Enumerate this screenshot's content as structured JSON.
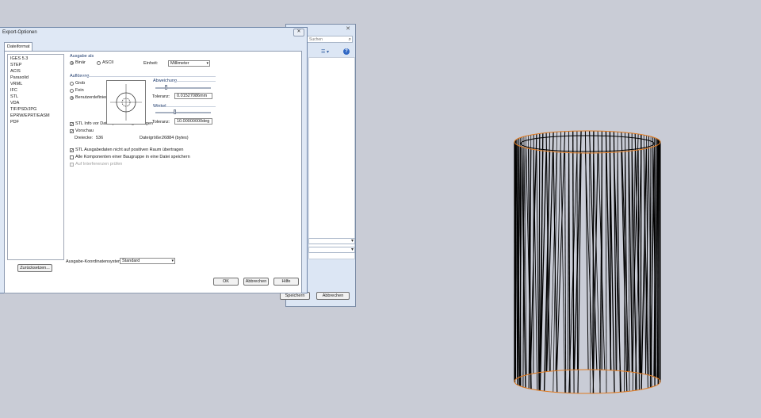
{
  "background_dialog": {
    "search_placeholder": "Suchen",
    "save_label": "Speichern",
    "cancel_label": "Abbrechen"
  },
  "export_dialog": {
    "title": "Export-Optionen",
    "close_label": "×",
    "tab_label": "Dateiformat",
    "formats": [
      "IGES 5.3",
      "STEP",
      "ACIS",
      "Parasolid",
      "VRML",
      "IFC",
      "STL",
      "VDA",
      "TIF/PSD/JPG",
      "EPRW/EPRT/EASM",
      "PDF"
    ],
    "output_as": {
      "label": "Ausgabe als",
      "binary_label": "Binär",
      "ascii_label": "ASCII",
      "selected": "Binär"
    },
    "unit": {
      "label": "Einheit:",
      "value": "Millimeter"
    },
    "resolution": {
      "label": "Auflösung",
      "coarse_label": "Grob",
      "fine_label": "Fein",
      "custom_label": "Benutzerdefiniert",
      "selected": "Benutzerdefiniert"
    },
    "deviation": {
      "label": "Abweichung",
      "tolerance_label": "Toleranz:",
      "value": "0.01527086mm"
    },
    "angle": {
      "label": "Winkel",
      "tolerance_label": "Toleranz:",
      "value": "10.00000000deg"
    },
    "options": {
      "stl_show_info": "STL Info vor Dateispeicherung anzeigen",
      "preview": "Vorschau",
      "triangles_label": "Dreiecke:",
      "triangles_value": "536",
      "filesize_label": "Dateigröße:",
      "filesize_value": "26884 (bytes)",
      "no_translate": "STL Ausgabedaten nicht auf positiven Raum übertragen",
      "one_file": "Alle Komponenten einer Baugruppe in eine Datei speichern",
      "check_interference": "Auf Interferenzen prüfen"
    },
    "coord_system": {
      "label": "Ausgabe-Koordinatensystem:",
      "value": "Standard"
    },
    "restore_button": "Zurücksetzen...",
    "ok_button": "OK",
    "cancel_button": "Abbrechen",
    "help_button": "Hilfe"
  },
  "icons": {
    "close": "close-icon",
    "search": "search-icon",
    "view": "view-menu-icon",
    "help": "help-icon",
    "dropdown": "chevron-down-icon"
  },
  "colors": {
    "viewport_bg": "#c9ccd6",
    "dialog_frame": "#dfe8f5",
    "model_edge": "#e07a1f",
    "model_lines": "#000000"
  }
}
